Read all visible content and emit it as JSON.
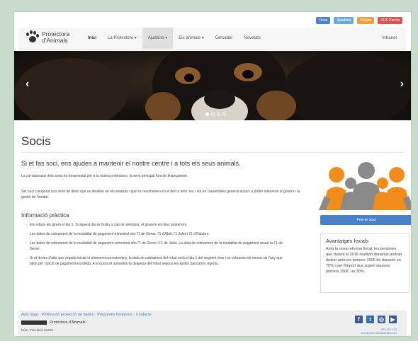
{
  "top_actions": [
    {
      "label": "Dona",
      "color": "#4a82c8"
    },
    {
      "label": "Apadrina",
      "color": "#6aa9dc"
    },
    {
      "label": "Adopta",
      "color": "#f0a23a"
    },
    {
      "label": "SOS Perdut",
      "color": "#d9534f"
    }
  ],
  "logo": {
    "line1": "Protectora",
    "line2": "d'Animals"
  },
  "nav": {
    "items": [
      {
        "label": "Inici"
      },
      {
        "label": "La Protectora ▾"
      },
      {
        "label": "Ajuda'ns ▾"
      },
      {
        "label": "Els animals ▾"
      },
      {
        "label": "Cercador"
      },
      {
        "label": "Novetats"
      }
    ],
    "intranet": "Intranet"
  },
  "carousel": {
    "prev": "‹",
    "next": "›"
  },
  "page_title": "Socis",
  "lead": "Si et fas soci, ens ajudes a mantenir el nostre centre i a tots els seus animals.",
  "p1": "La col·laboració dels socis és fonamental per a la nostra protectora i la seva principal font de finançament.",
  "p2": "Ser soci comporta una sèrie de drets que es detallen en els estatuts i que es resumeixen en el dret a tenir veu i vot en l'assemblea general anual i a poder intervenir al govern i la gestió de l'entitat.",
  "info_title": "Informació pràctica",
  "bullets": [
    "Els rebuts els girem el dia 1. Si aquest dia és festiu o cap de setmana, el girarem els dies posteriors.",
    "Les dates de cobrament de la modalitat de pagament trimestral són l'1 de Gener, l'1 d'Abril, l'1 Juliol i l'1 d'Octubre.",
    "Les dates de cobrament de la modalitat de pagament semestral són l'1 de Gener i l'1 de Juliol. La data de cobrament de la modalitat de pagament anual és l'1 de Gener.",
    "Si et dones d'alta una vegada iniciat el trimestre/semestre/any, la data de cobrament del rebut serà el dia 1 del següent mes i es cobraran els mesos de l'any que faltin per l'opció de pagament escollida. A la quota et sumarem la despesa del rebut segons les tarifes bancàries vigents."
  ],
  "join_button": "Fes-te soci",
  "fiscal": {
    "title": "Avantatges fiscals",
    "text": "Amb la nova reforma fiscal, les persones que durant el 2016 realitzin donatius podran deduir amb els primers 150€ de donació un 75% i per l'import que superi aquests primers 150€, un 30%."
  },
  "footer": {
    "links": "Avís legal · Política de protecció de dades · Preguntes freqüents · Contacte",
    "org_name": "Protectora d'Animals",
    "reg": "Núm. Inscripció 53469",
    "social": [
      "f",
      "t",
      "◎",
      "▶"
    ],
    "contact_line1": "972 570 133",
    "contact_line2": "info@protectoraanimals.com"
  },
  "colors": {
    "accent": "#4a82c8",
    "orange": "#f28c1b",
    "grey": "#8a8a8a"
  }
}
